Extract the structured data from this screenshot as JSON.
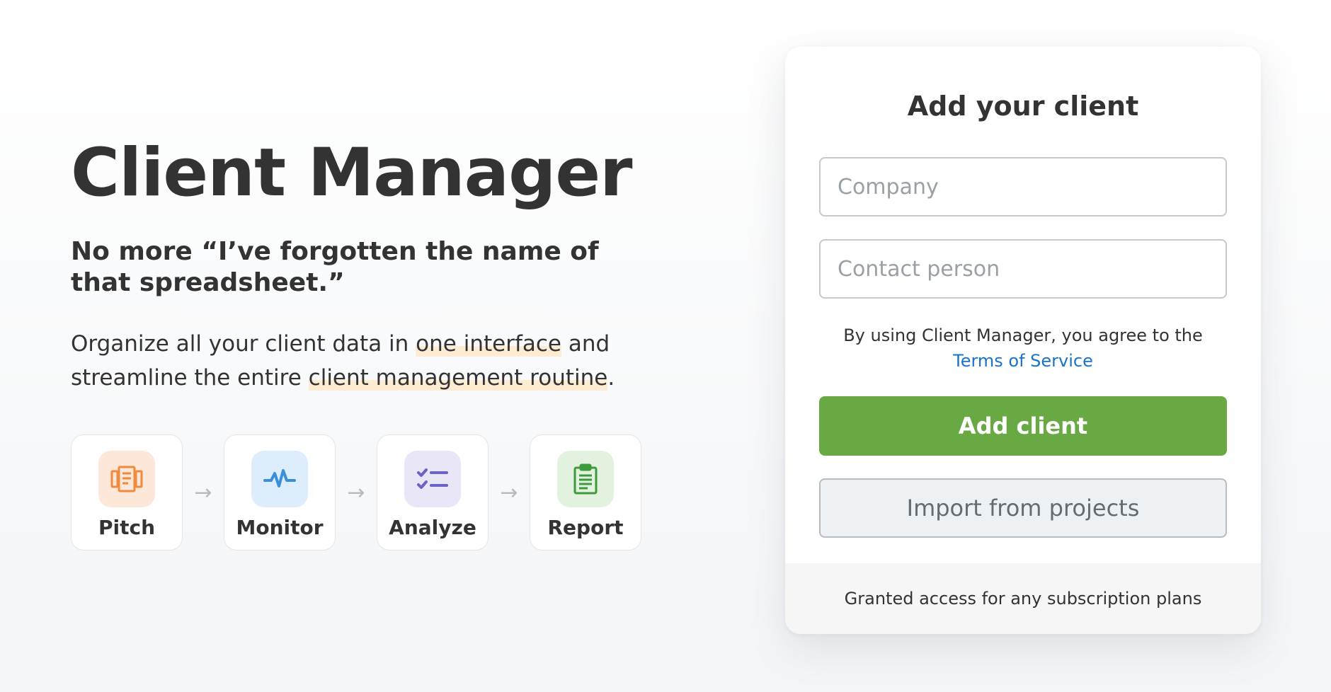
{
  "hero": {
    "title": "Client Manager",
    "subtitle": "No more “I’ve forgotten the name of that spreadsheet.”",
    "description": {
      "part1": "Organize all your client data in ",
      "highlight1": "one interface",
      "part2": " and streamline the entire ",
      "highlight2": "client management routine",
      "part3": "."
    },
    "steps": [
      {
        "label": "Pitch",
        "icon": "pitch-icon",
        "color": "#f08a3c",
        "bg": "#fde7d9"
      },
      {
        "label": "Monitor",
        "icon": "monitor-icon",
        "color": "#3a8fdc",
        "bg": "#deedfb"
      },
      {
        "label": "Analyze",
        "icon": "analyze-icon",
        "color": "#6b63c8",
        "bg": "#e8e6f7"
      },
      {
        "label": "Report",
        "icon": "report-icon",
        "color": "#3e9b3c",
        "bg": "#e3f2de"
      }
    ],
    "arrow": "→"
  },
  "form": {
    "title": "Add your client",
    "company_placeholder": "Company",
    "contact_placeholder": "Contact person",
    "terms_text": "By using Client Manager, you agree to the ",
    "terms_link": "Terms of Service",
    "add_button": "Add client",
    "import_button": "Import from projects",
    "footer": "Granted access for any subscription plans"
  },
  "colors": {
    "primary": "#68a944",
    "link": "#1a73c8",
    "highlight": "#fdecd2"
  }
}
